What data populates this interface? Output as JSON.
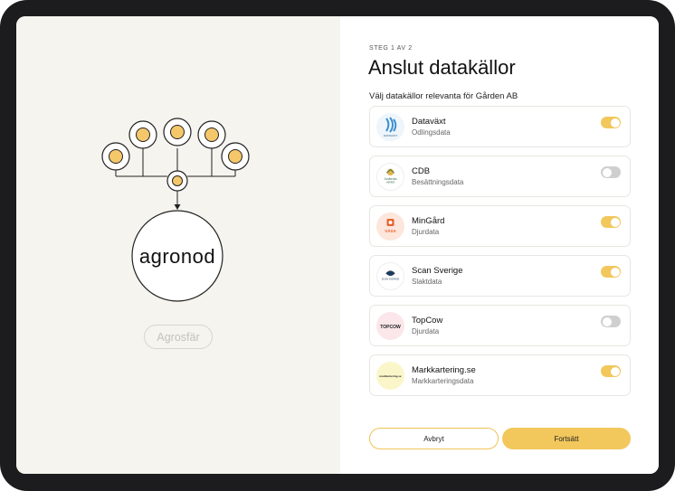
{
  "left_panel": {
    "brand_name": "agronod",
    "agrosfar_label": "Agrosfär"
  },
  "header": {
    "step": "STEG 1 AV 2",
    "title": "Anslut datakällor",
    "subtitle": "Välj datakällor relevanta för Gården AB"
  },
  "sources": [
    {
      "name": "Dataväxt",
      "description": "Odlingsdata",
      "enabled": true,
      "logo_icon": "dataväxt-logo",
      "logo_text": "DATAVÄXT"
    },
    {
      "name": "CDB",
      "description": "Besättningsdata",
      "enabled": false,
      "logo_icon": "jordbruksverket-logo",
      "logo_text": "Jordbruks verket"
    },
    {
      "name": "MinGård",
      "description": "Djurdata",
      "enabled": true,
      "logo_icon": "vaxa-logo",
      "logo_text": "VÄXA"
    },
    {
      "name": "Scan Sverige",
      "description": "Slaktdata",
      "enabled": true,
      "logo_icon": "scan-logo",
      "logo_text": "SCAN SVERIGE"
    },
    {
      "name": "TopCow",
      "description": "Djurdata",
      "enabled": false,
      "logo_icon": "topcow-logo",
      "logo_text": "TOPCOW"
    },
    {
      "name": "Markkartering.se",
      "description": "Markkarteringsdata",
      "enabled": true,
      "logo_icon": "markkartering-logo",
      "logo_text": "markkartering.se"
    }
  ],
  "footer": {
    "cancel_label": "Avbryt",
    "continue_label": "Fortsätt"
  },
  "colors": {
    "accent": "#f2c75c",
    "node_fill": "#f5c76b",
    "left_bg": "#f5f4ef"
  }
}
